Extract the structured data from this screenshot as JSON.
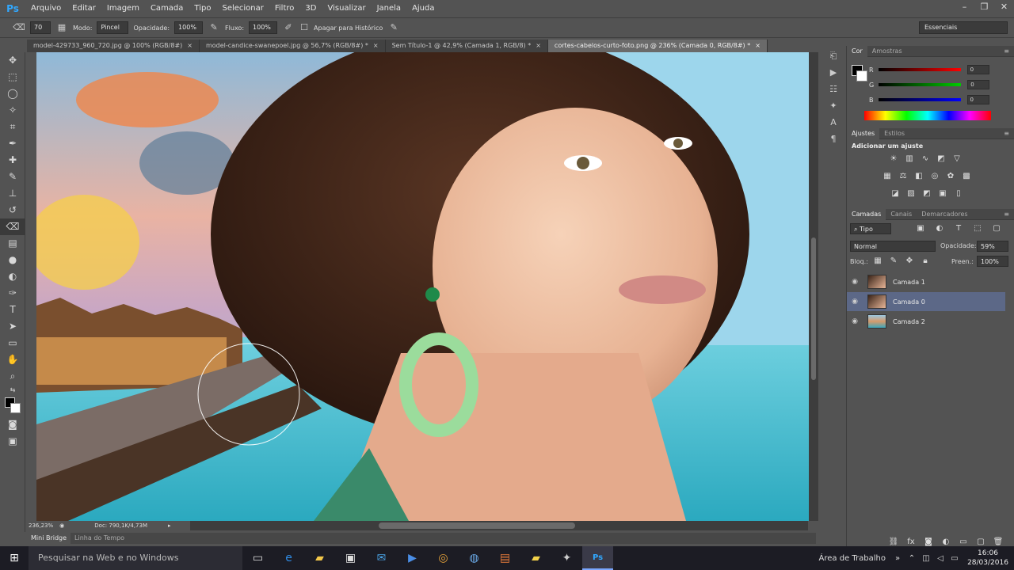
{
  "app": {
    "logo": "Ps",
    "menu": [
      "Arquivo",
      "Editar",
      "Imagem",
      "Camada",
      "Tipo",
      "Selecionar",
      "Filtro",
      "3D",
      "Visualizar",
      "Janela",
      "Ajuda"
    ],
    "window_controls": [
      "–",
      "❐",
      "✕"
    ]
  },
  "options_bar": {
    "brush_size": "70",
    "mode_label": "Modo:",
    "mode_value": "Pincel",
    "opacity_label": "Opacidade:",
    "opacity_value": "100%",
    "flow_label": "Fluxo:",
    "flow_value": "100%",
    "erase_history_label": "Apagar para Histórico",
    "workspace": "Essenciais"
  },
  "tabs": [
    {
      "label": "model-429733_960_720.jpg @ 100% (RGB/8#)",
      "active": false
    },
    {
      "label": "model-candice-swanepoel.jpg @ 56,7% (RGB/8#) *",
      "active": false
    },
    {
      "label": "Sem Título-1 @ 42,9% (Camada 1, RGB/8) *",
      "active": false
    },
    {
      "label": "cortes-cabelos-curto-foto.png @ 236% (Camada 0, RGB/8#) *",
      "active": true
    }
  ],
  "status": {
    "zoom": "236,23%",
    "doc": "Doc: 790,1K/4,73M"
  },
  "bottom_tabs": [
    "Mini Bridge",
    "Linha do Tempo"
  ],
  "color_panel": {
    "tabs": [
      "Cor",
      "Amostras"
    ],
    "channels": [
      {
        "label": "R",
        "value": "0"
      },
      {
        "label": "G",
        "value": "0"
      },
      {
        "label": "B",
        "value": "0"
      }
    ]
  },
  "adjustments_panel": {
    "tabs": [
      "Ajustes",
      "Estilos"
    ],
    "title": "Adicionar um ajuste"
  },
  "layers_panel": {
    "tabs": [
      "Camadas",
      "Canais",
      "Demarcadores"
    ],
    "filter": "Tipo",
    "blend_mode": "Normal",
    "opacity_label": "Opacidade:",
    "opacity_value": "59%",
    "lock_label": "Bloq.:",
    "fill_label": "Preen.:",
    "fill_value": "100%",
    "layers": [
      {
        "name": "Camada 1",
        "selected": false
      },
      {
        "name": "Camada 0",
        "selected": true
      },
      {
        "name": "Camada 2",
        "selected": false
      }
    ]
  },
  "taskbar": {
    "search_placeholder": "Pesquisar na Web e no Windows",
    "desktop_label": "Área de Trabalho",
    "time": "16:06",
    "date": "28/03/2016"
  }
}
